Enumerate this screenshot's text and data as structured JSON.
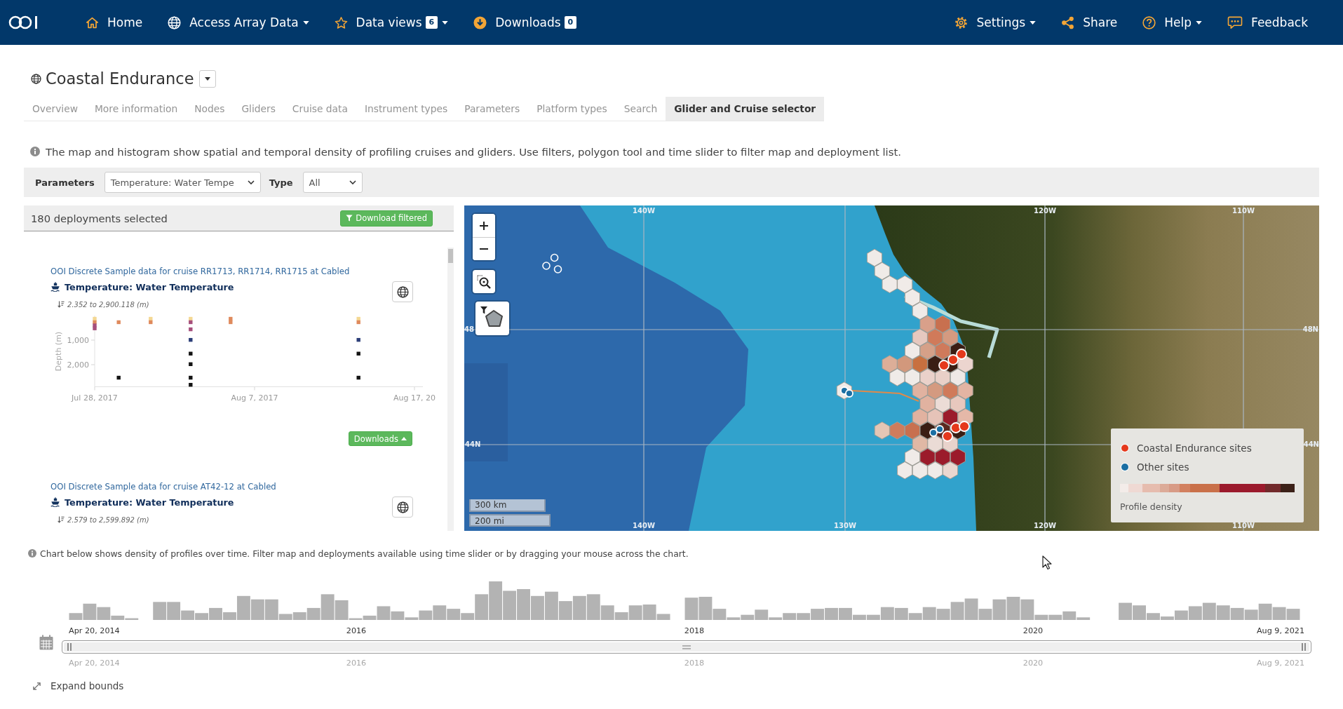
{
  "nav": {
    "left": [
      {
        "label": "Home",
        "dropdown": false
      },
      {
        "label": "Access Array Data",
        "dropdown": true
      },
      {
        "label": "Data views",
        "badge": "6",
        "dropdown": true
      },
      {
        "label": "Downloads",
        "badge": "0",
        "dropdown": false
      }
    ],
    "right": [
      {
        "label": "Settings",
        "dropdown": true
      },
      {
        "label": "Share",
        "dropdown": false
      },
      {
        "label": "Help",
        "dropdown": true
      },
      {
        "label": "Feedback",
        "dropdown": false
      }
    ]
  },
  "site": {
    "title": "Coastal Endurance"
  },
  "tabs": [
    {
      "label": "Overview",
      "selected": false
    },
    {
      "label": "More information",
      "selected": false
    },
    {
      "label": "Nodes",
      "selected": false
    },
    {
      "label": "Gliders",
      "selected": false
    },
    {
      "label": "Cruise data",
      "selected": false
    },
    {
      "label": "Instrument types",
      "selected": false
    },
    {
      "label": "Parameters",
      "selected": false
    },
    {
      "label": "Platform types",
      "selected": false
    },
    {
      "label": "Search",
      "selected": false
    },
    {
      "label": "Glider and Cruise selector",
      "selected": true
    }
  ],
  "intro": "The map and histogram show spatial and temporal density of profiling cruises and gliders. Use filters, polygon tool and time slider to filter map and deployment list.",
  "filters": [
    {
      "label": "Parameters",
      "value": "Temperature: Water Tempe"
    },
    {
      "label": "Type",
      "value": "All"
    }
  ],
  "deployments": {
    "summary": "180 deployments selected",
    "download_button": "Download filtered",
    "items": [
      {
        "link": "OOI Discrete Sample data for cruise RR1713, RR1714, RR1715 at Cabled",
        "title": "Temperature: Water Temperature",
        "depth_range": "2.352 to 2,900.118 (m)",
        "chart_data": {
          "type": "scatter",
          "ylabel": "Depth (m)",
          "categories": [
            "Jul 28, 2017",
            null,
            null,
            null,
            null,
            null,
            null,
            null,
            null,
            null,
            null,
            null,
            null,
            null,
            null,
            null,
            null,
            null,
            null,
            null,
            "Aug 7, 2017",
            null,
            null,
            null,
            null,
            null,
            null,
            null,
            null,
            null,
            null,
            null,
            null,
            null,
            null,
            null,
            null,
            null,
            null,
            null,
            "Aug 17, 20"
          ],
          "ylim": [
            2900,
            0
          ],
          "yticks": [
            {
              "value": 1000,
              "label": "1,000"
            },
            {
              "value": 2000,
              "label": "2,000"
            }
          ],
          "series": [
            {
              "color": "#f4d893",
              "values": [
                130,
                null,
                null,
                null,
                null,
                null,
                null,
                130,
                null,
                null,
                null,
                null,
                130,
                null,
                null,
                null,
                null,
                null,
                null,
                null,
                null,
                null,
                null,
                null,
                null,
                null,
                null,
                null,
                null,
                null,
                null,
                null,
                null,
                130,
                null,
                null,
                null,
                null,
                null,
                null,
                null
              ]
            },
            {
              "color": "#df8a5d",
              "values": [
                270,
                null,
                null,
                270,
                null,
                null,
                null,
                270,
                null,
                null,
                null,
                null,
                null,
                null,
                null,
                null,
                null,
                270,
                null,
                null,
                null,
                null,
                null,
                null,
                null,
                null,
                null,
                null,
                null,
                null,
                null,
                null,
                null,
                270,
                null,
                null,
                null,
                null,
                null,
                null,
                null
              ]
            },
            {
              "color": "#df8a5d",
              "values": [
                null,
                null,
                null,
                null,
                null,
                null,
                null,
                null,
                null,
                null,
                null,
                null,
                null,
                null,
                null,
                null,
                null,
                130,
                null,
                null,
                null,
                null,
                null,
                null,
                null,
                null,
                null,
                null,
                null,
                null,
                null,
                null,
                null,
                null,
                null,
                null,
                null,
                null,
                null,
                null,
                null
              ]
            },
            {
              "color": "#a64f7c",
              "values": [
                400,
                null,
                null,
                null,
                null,
                null,
                null,
                null,
                null,
                null,
                null,
                null,
                270,
                null,
                null,
                null,
                null,
                null,
                null,
                null,
                null,
                null,
                null,
                null,
                null,
                null,
                null,
                null,
                null,
                null,
                null,
                null,
                null,
                null,
                null,
                null,
                null,
                null,
                null,
                null,
                null
              ]
            },
            {
              "color": "#a64f7c",
              "values": [
                520,
                null,
                null,
                null,
                null,
                null,
                null,
                null,
                null,
                null,
                null,
                null,
                560,
                null,
                null,
                null,
                null,
                null,
                null,
                null,
                null,
                null,
                null,
                null,
                null,
                null,
                null,
                null,
                null,
                null,
                null,
                null,
                null,
                null,
                null,
                null,
                null,
                null,
                null,
                null,
                null
              ]
            },
            {
              "color": "#2c3e78",
              "values": [
                null,
                null,
                null,
                null,
                null,
                null,
                null,
                null,
                null,
                null,
                null,
                null,
                990,
                null,
                null,
                null,
                null,
                null,
                null,
                null,
                null,
                null,
                null,
                null,
                null,
                null,
                null,
                null,
                null,
                null,
                null,
                null,
                null,
                990,
                null,
                null,
                null,
                null,
                null,
                null,
                null
              ]
            },
            {
              "color": "#141414",
              "values": [
                null,
                null,
                null,
                2530,
                null,
                null,
                null,
                null,
                null,
                null,
                null,
                null,
                1550,
                null,
                null,
                null,
                null,
                null,
                null,
                null,
                null,
                null,
                null,
                null,
                null,
                null,
                null,
                null,
                null,
                null,
                null,
                null,
                null,
                1550,
                null,
                null,
                null,
                null,
                null,
                null,
                null
              ]
            },
            {
              "color": "#141414",
              "values": [
                null,
                null,
                null,
                null,
                null,
                null,
                null,
                null,
                null,
                null,
                null,
                null,
                1980,
                null,
                null,
                null,
                null,
                null,
                null,
                null,
                null,
                null,
                null,
                null,
                null,
                null,
                null,
                null,
                null,
                null,
                null,
                null,
                null,
                2530,
                null,
                null,
                null,
                null,
                null,
                null,
                null
              ]
            },
            {
              "color": "#141414",
              "values": [
                null,
                null,
                null,
                null,
                null,
                null,
                null,
                null,
                null,
                null,
                null,
                null,
                2530,
                null,
                null,
                null,
                null,
                null,
                null,
                null,
                null,
                null,
                null,
                null,
                null,
                null,
                null,
                null,
                null,
                null,
                null,
                null,
                null,
                null,
                null,
                null,
                null,
                null,
                null,
                null,
                null
              ]
            },
            {
              "color": "#141414",
              "values": [
                null,
                null,
                null,
                null,
                null,
                null,
                null,
                null,
                null,
                null,
                null,
                null,
                2820,
                null,
                null,
                null,
                null,
                null,
                null,
                null,
                null,
                null,
                null,
                null,
                null,
                null,
                null,
                null,
                null,
                null,
                null,
                null,
                null,
                null,
                null,
                null,
                null,
                null,
                null,
                null,
                null
              ]
            }
          ]
        },
        "downloads_button": "Downloads"
      },
      {
        "link": "OOI Discrete Sample data for cruise AT42-12 at Cabled",
        "title": "Temperature: Water Temperature",
        "depth_range": "2.579 to 2,599.892 (m)"
      }
    ]
  },
  "map": {
    "grid_labels": [
      "140W",
      "120W",
      "110W",
      "48",
      "48N",
      "44N",
      "44N",
      "140W",
      "130W",
      "120W",
      "110W"
    ],
    "scale": [
      "300 km",
      "200 mi"
    ],
    "hexbins": [
      {
        "color": "#f0ebe8"
      },
      {
        "color": "#f0ebe8"
      },
      {
        "color": "#f0ebe8"
      },
      {
        "color": "#f0ebe8"
      },
      {
        "color": "#f0ebe8"
      },
      {
        "color": "#f0ebe8"
      },
      {
        "color": "#d9a08a"
      },
      {
        "color": "#c8704f"
      },
      {
        "color": "#e6c8bf"
      },
      {
        "color": "#d07a5a"
      },
      {
        "color": "#d49a80"
      },
      {
        "color": "#f0ebe8"
      },
      {
        "color": "#d5a088"
      },
      {
        "color": "#cf7a5b"
      },
      {
        "color": "#3a1e14"
      },
      {
        "color": "#dcae98"
      },
      {
        "color": "#d2987c"
      },
      {
        "color": "#c8703f"
      },
      {
        "color": "#3a1e14"
      },
      {
        "color": "#3a1e14"
      },
      {
        "color": "#ecd5cf"
      },
      {
        "color": "#f0ebe8"
      },
      {
        "color": "#f0ebe8"
      },
      {
        "color": "#ead1ca"
      },
      {
        "color": "#e9d0c8"
      },
      {
        "color": "#efe8e6"
      },
      {
        "color": "#f0ebe8"
      },
      {
        "color": "#e1b2a0"
      },
      {
        "color": "#d49a80"
      },
      {
        "color": "#d07a5a"
      },
      {
        "color": "#e3b4a3"
      },
      {
        "color": "#e1b2a0"
      },
      {
        "color": "#ecdcd6"
      },
      {
        "color": "#e8c8be"
      },
      {
        "color": "#e1b2a0"
      },
      {
        "color": "#e6c3b8"
      },
      {
        "color": "#9b1b2b"
      },
      {
        "color": "#e5b8a8"
      },
      {
        "color": "#e4c6b5"
      },
      {
        "color": "#cf7c5c"
      },
      {
        "color": "#c8704f"
      },
      {
        "color": "#3a1e14"
      },
      {
        "color": "#5a2820"
      },
      {
        "color": "#3a1e14"
      },
      {
        "color": "#e0b8a5"
      },
      {
        "color": "#eadbd5"
      },
      {
        "color": "#e9d3cc"
      },
      {
        "color": "#f0ebe8"
      },
      {
        "color": "#9b1b2b"
      },
      {
        "color": "#9b1b2b"
      },
      {
        "color": "#9b1b2b"
      },
      {
        "color": "#f0ebe8"
      },
      {
        "color": "#f0ebe8"
      },
      {
        "color": "#f0ebe8"
      },
      {
        "color": "#ead7d0"
      }
    ],
    "sites": [
      {
        "color": "#1b6fa3"
      },
      {
        "color": "#1b6fa3"
      },
      {
        "color": "#e5391c"
      },
      {
        "color": "#e5391c"
      },
      {
        "color": "#e5391c"
      },
      {
        "color": "#1b6fa3"
      },
      {
        "color": "#1b6fa3"
      },
      {
        "color": "#e5391c"
      },
      {
        "color": "#e5391c"
      },
      {
        "color": "#e5391c"
      }
    ],
    "legend": {
      "items": [
        {
          "label": "Coastal Endurance sites",
          "color": "#e5391c"
        },
        {
          "label": "Other sites",
          "color": "#1b6fa3"
        }
      ],
      "ramp_label": "Profile density"
    }
  },
  "timeline": {
    "info": "Chart below shows density of profiles over time. Filter map and deployments available using time slider or by dragging your mouse across the chart.",
    "ticks": [
      "Apr 20, 2014",
      "2016",
      "2018",
      "2020",
      "Aug 9, 2021"
    ],
    "slider": {
      "level": 1
    },
    "range_ticks": [
      "Apr 20, 2014",
      "2016",
      "2018",
      "2020",
      "Aug 9, 2021"
    ],
    "expand": "Expand bounds"
  }
}
